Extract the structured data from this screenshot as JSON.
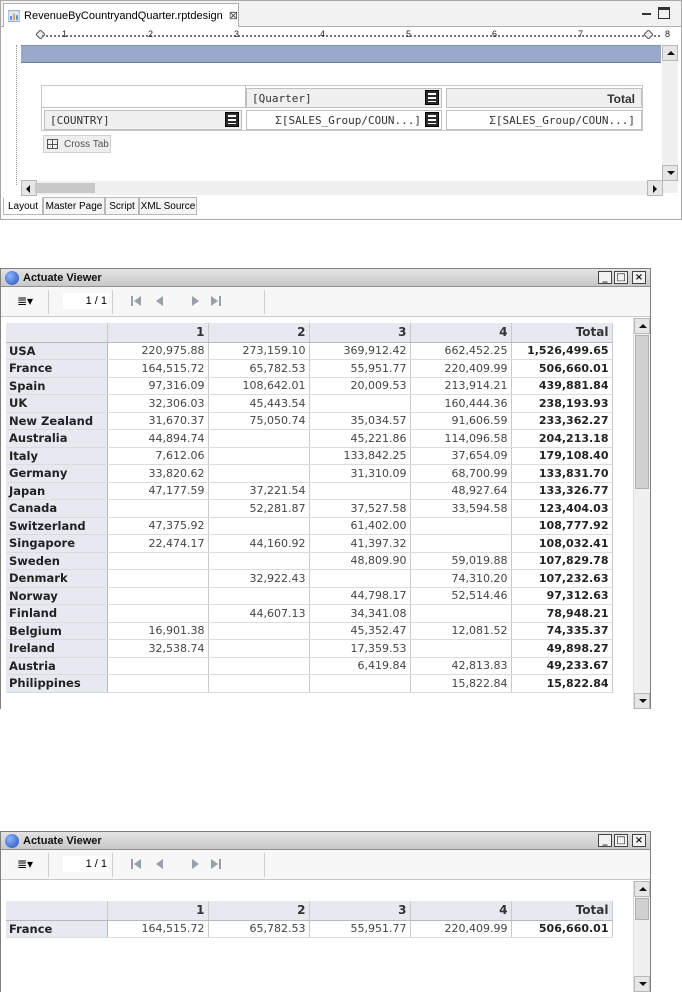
{
  "designer": {
    "tab_title": "RevenueByCountryandQuarter.rptdesign",
    "ruler_numbers": [
      "1",
      "2",
      "3",
      "4",
      "5",
      "6",
      "7",
      "8"
    ],
    "quarter_cell": "[Quarter]",
    "total_header": "Total",
    "country_cell": "[COUNTRY]",
    "measure_cell": "Σ[SALES_Group/COUN...]",
    "measure_total_cell": "Σ[SALES_Group/COUN...]",
    "crosstab_label": "Cross Tab",
    "bottom_tabs": [
      "Layout",
      "Master Page",
      "Script",
      "XML Source"
    ],
    "active_tab": "Layout"
  },
  "viewer1": {
    "title": "Actuate Viewer",
    "page_indicator": "1 / 1",
    "columns": [
      "1",
      "2",
      "3",
      "4",
      "Total"
    ],
    "rows": [
      {
        "country": "USA",
        "q1": "220,975.88",
        "q2": "273,159.10",
        "q3": "369,912.42",
        "q4": "662,452.25",
        "total": "1,526,499.65"
      },
      {
        "country": "France",
        "q1": "164,515.72",
        "q2": "65,782.53",
        "q3": "55,951.77",
        "q4": "220,409.99",
        "total": "506,660.01"
      },
      {
        "country": "Spain",
        "q1": "97,316.09",
        "q2": "108,642.01",
        "q3": "20,009.53",
        "q4": "213,914.21",
        "total": "439,881.84"
      },
      {
        "country": "UK",
        "q1": "32,306.03",
        "q2": "45,443.54",
        "q3": "",
        "q4": "160,444.36",
        "total": "238,193.93"
      },
      {
        "country": "New Zealand",
        "q1": "31,670.37",
        "q2": "75,050.74",
        "q3": "35,034.57",
        "q4": "91,606.59",
        "total": "233,362.27"
      },
      {
        "country": "Australia",
        "q1": "44,894.74",
        "q2": "",
        "q3": "45,221.86",
        "q4": "114,096.58",
        "total": "204,213.18"
      },
      {
        "country": "Italy",
        "q1": "7,612.06",
        "q2": "",
        "q3": "133,842.25",
        "q4": "37,654.09",
        "total": "179,108.40"
      },
      {
        "country": "Germany",
        "q1": "33,820.62",
        "q2": "",
        "q3": "31,310.09",
        "q4": "68,700.99",
        "total": "133,831.70"
      },
      {
        "country": "Japan",
        "q1": "47,177.59",
        "q2": "37,221.54",
        "q3": "",
        "q4": "48,927.64",
        "total": "133,326.77"
      },
      {
        "country": "Canada",
        "q1": "",
        "q2": "52,281.87",
        "q3": "37,527.58",
        "q4": "33,594.58",
        "total": "123,404.03"
      },
      {
        "country": "Switzerland",
        "q1": "47,375.92",
        "q2": "",
        "q3": "61,402.00",
        "q4": "",
        "total": "108,777.92"
      },
      {
        "country": "Singapore",
        "q1": "22,474.17",
        "q2": "44,160.92",
        "q3": "41,397.32",
        "q4": "",
        "total": "108,032.41"
      },
      {
        "country": "Sweden",
        "q1": "",
        "q2": "",
        "q3": "48,809.90",
        "q4": "59,019.88",
        "total": "107,829.78"
      },
      {
        "country": "Denmark",
        "q1": "",
        "q2": "32,922.43",
        "q3": "",
        "q4": "74,310.20",
        "total": "107,232.63"
      },
      {
        "country": "Norway",
        "q1": "",
        "q2": "",
        "q3": "44,798.17",
        "q4": "52,514.46",
        "total": "97,312.63"
      },
      {
        "country": "Finland",
        "q1": "",
        "q2": "44,607.13",
        "q3": "34,341.08",
        "q4": "",
        "total": "78,948.21"
      },
      {
        "country": "Belgium",
        "q1": "16,901.38",
        "q2": "",
        "q3": "45,352.47",
        "q4": "12,081.52",
        "total": "74,335.37"
      },
      {
        "country": "Ireland",
        "q1": "32,538.74",
        "q2": "",
        "q3": "17,359.53",
        "q4": "",
        "total": "49,898.27"
      },
      {
        "country": "Austria",
        "q1": "",
        "q2": "",
        "q3": "6,419.84",
        "q4": "42,813.83",
        "total": "49,233.67"
      },
      {
        "country": "Philippines",
        "q1": "",
        "q2": "",
        "q3": "",
        "q4": "15,822.84",
        "total": "15,822.84"
      }
    ]
  },
  "viewer2": {
    "title": "Actuate Viewer",
    "page_indicator": "1 / 1",
    "columns": [
      "1",
      "2",
      "3",
      "4",
      "Total"
    ],
    "rows": [
      {
        "country": "France",
        "q1": "164,515.72",
        "q2": "65,782.53",
        "q3": "55,951.77",
        "q4": "220,409.99",
        "total": "506,660.01"
      }
    ]
  }
}
